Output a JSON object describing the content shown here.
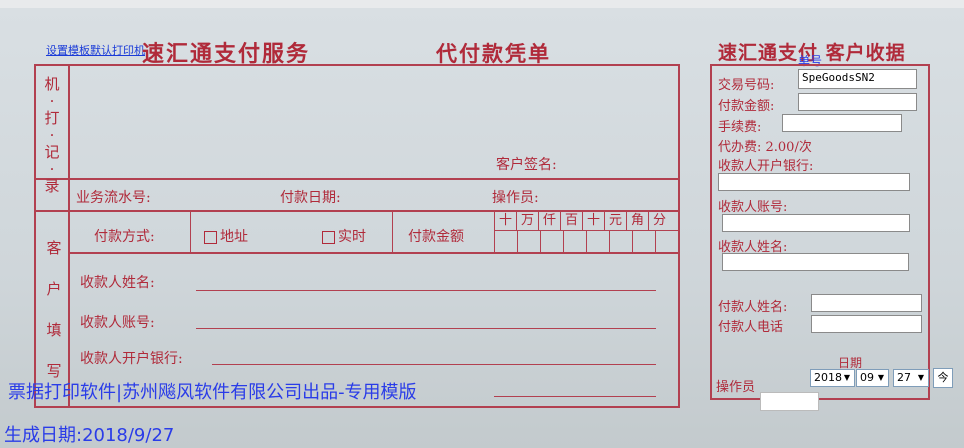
{
  "template_link": "设置模板默认打印机",
  "left": {
    "title": "速汇通支付服务",
    "subtitle": "代付款凭单",
    "machine_section": [
      "机",
      "·",
      "打",
      "·",
      "记",
      "·",
      "录"
    ],
    "customer_sign": "客户签名:",
    "serial_no": "业务流水号:",
    "pay_date": "付款日期:",
    "operator": "操作员:",
    "customer_section": [
      "客",
      "户",
      "填",
      "写"
    ],
    "pay_method": "付款方式:",
    "opt_address": "地址",
    "opt_realtime": "实时",
    "pay_amount": "付款金额",
    "digits": [
      "十",
      "万",
      "仟",
      "百",
      "十",
      "元",
      "角",
      "分"
    ],
    "payee_name": "收款人姓名:",
    "payee_account": "收款人账号:",
    "payee_bank": "收款人开户银行:"
  },
  "right": {
    "title": "速汇通支付 客户收据",
    "order_label": "单号",
    "txn_no": "交易号码:",
    "txn_no_value": "SpeGoodsSN2",
    "pay_amount": "付款金额:",
    "fee": "手续费:",
    "agent_fee": "代办费: 2.00/次",
    "payee_bank": "收款人开户银行:",
    "payee_account": "收款人账号:",
    "payee_name": "收款人姓名:",
    "payer_name": "付款人姓名:",
    "payer_phone": "付款人电话",
    "date_label": "日期",
    "operator": "操作员",
    "date_year": "2018",
    "date_month": "09",
    "date_day": "27"
  },
  "footer": {
    "brand": "票据打印软件|苏州飚风软件有限公司出品-专用模版",
    "gen_date": "生成日期:2018/9/27"
  }
}
